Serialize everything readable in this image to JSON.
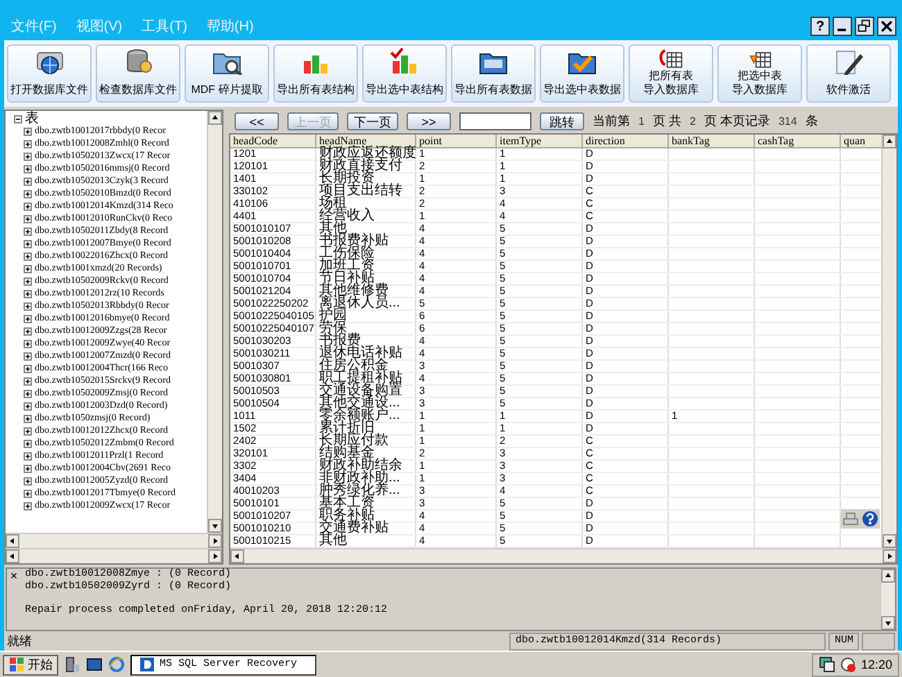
{
  "menu": [
    "文件(F)",
    "视图(V)",
    "工具(T)",
    "帮助(H)"
  ],
  "window_controls": {
    "help": "?"
  },
  "toolbar": [
    {
      "label": "打开数据库文件"
    },
    {
      "label": "检查数据库文件"
    },
    {
      "label": "MDF 碎片提取"
    },
    {
      "label": "导出所有表结构"
    },
    {
      "label": "导出选中表结构"
    },
    {
      "label": "导出所有表数据"
    },
    {
      "label": "导出选中表数据"
    },
    {
      "label": "把所有表",
      "label_2": "导入数据库"
    },
    {
      "label": "把选中表",
      "label_2": "导入数据库"
    },
    {
      "label": "软件激活"
    }
  ],
  "tree": {
    "label": "表",
    "expanded": true,
    "children": [
      {
        "label": "dbo.zwtb10012017rbbdy(0 Recor",
        "expanded": false
      },
      {
        "label": "dbo.zwtb10012008Zmhl(0 Record",
        "expanded": false
      },
      {
        "label": "dbo.zwtb10502013Zwcx(17 Recor",
        "expanded": false
      },
      {
        "label": "dbo.zwtb10502016mmsj(0 Record",
        "expanded": false
      },
      {
        "label": "dbo.zwtb10502013Czyk(3 Record",
        "expanded": false
      },
      {
        "label": "dbo.zwtb10502010Bmzd(0 Record",
        "expanded": false
      },
      {
        "label": "dbo.zwtb10012014Kmzd(314 Reco",
        "expanded": false
      },
      {
        "label": "dbo.zwtb10012010RunCkv(0 Reco",
        "expanded": false
      },
      {
        "label": "dbo.zwtb10502011Zbdy(8 Record",
        "expanded": false
      },
      {
        "label": "dbo.zwtb10012007Bmye(0 Record",
        "expanded": false
      },
      {
        "label": "dbo.zwtb10022016Zhcx(0 Record",
        "expanded": false
      },
      {
        "label": "dbo.zwtb1001xmzd(20 Records)",
        "expanded": false
      },
      {
        "label": "dbo.zwtb10502009Rckv(0 Record",
        "expanded": false
      },
      {
        "label": "dbo.zwtb10012012rz(10 Records",
        "expanded": false
      },
      {
        "label": "dbo.zwtb10502013Rbbdy(0 Recor",
        "expanded": false
      },
      {
        "label": "dbo.zwtb10012016bmye(0 Record",
        "expanded": false
      },
      {
        "label": "dbo.zwtb10012009Zzgs(28 Recor",
        "expanded": false
      },
      {
        "label": "dbo.zwtb10012009Zwye(40 Recor",
        "expanded": false
      },
      {
        "label": "dbo.zwtb10012007Zmzd(0 Record",
        "expanded": false
      },
      {
        "label": "dbo.zwtb10012004Thcr(166 Reco",
        "expanded": false
      },
      {
        "label": "dbo.zwtb10502015Srckv(9 Record",
        "expanded": false
      },
      {
        "label": "dbo.zwtb10502009Zmsj(0 Record",
        "expanded": false
      },
      {
        "label": "dbo.zwtb10012003Dzd(0 Record)",
        "expanded": false
      },
      {
        "label": "dbo.zwtb1050zmsj(0 Record)",
        "expanded": false
      },
      {
        "label": "dbo.zwtb10012012Zhcx(0 Record",
        "expanded": false
      },
      {
        "label": "dbo.zwtb10502012Zmbm(0 Record",
        "expanded": false
      },
      {
        "label": "dbo.zwtb10012011Przl(1 Record",
        "expanded": false
      },
      {
        "label": "dbo.zwtb10012004Cbv(2691 Reco",
        "expanded": false
      },
      {
        "label": "dbo.zwtb10012005Zyzd(0 Record",
        "expanded": false
      },
      {
        "label": "dbo.zwtb10012017Tbmye(0 Record",
        "expanded": false
      },
      {
        "label": "dbo.zwtb10012009Zwcx(17 Recor",
        "expanded": false
      }
    ]
  },
  "pager": {
    "first": "<<",
    "prev": {
      "label": "上一页",
      "disabled": true
    },
    "next": {
      "label": "下一页",
      "disabled": false
    },
    "last": ">>",
    "go": "跳转",
    "info": [
      {
        "text": "当前第",
        "kind": "label"
      },
      {
        "text": "1",
        "kind": "value"
      },
      {
        "text": "页 共",
        "kind": "label"
      },
      {
        "text": "2",
        "kind": "value"
      },
      {
        "text": "页 本页记录",
        "kind": "label"
      },
      {
        "text": "314",
        "kind": "value"
      },
      {
        "text": "条",
        "kind": "label"
      }
    ]
  },
  "table": {
    "columns": [
      "headCode",
      "headName",
      "point",
      "itemType",
      "direction",
      "bankTag",
      "cashTag",
      "quan"
    ],
    "rows": [
      [
        "1201",
        "财政应返还额度",
        "1",
        "1",
        "D"
      ],
      [
        "120101",
        "财政直接支付",
        "2",
        "1",
        "D"
      ],
      [
        "1401",
        "长期投资",
        "1",
        "1",
        "D"
      ],
      [
        "330102",
        "项目支出结转",
        "2",
        "3",
        "C"
      ],
      [
        "410106",
        "场租",
        "2",
        "4",
        "C"
      ],
      [
        "4401",
        "经营收入",
        "1",
        "4",
        "C"
      ],
      [
        "5001010107",
        "其他",
        "4",
        "5",
        "D"
      ],
      [
        "5001010208",
        "书报费补贴",
        "4",
        "5",
        "D"
      ],
      [
        "5001010404",
        "工伤保险",
        "4",
        "5",
        "D"
      ],
      [
        "5001010701",
        "加班工资",
        "4",
        "5",
        "D"
      ],
      [
        "5001010704",
        "节日补贴",
        "4",
        "5",
        "D"
      ],
      [
        "5001021204",
        "其他维修费",
        "4",
        "5",
        "D"
      ],
      [
        "5001022250202",
        "离退休人员...",
        "5",
        "5",
        "D"
      ],
      [
        "50010225040105",
        "护园",
        "6",
        "5",
        "D"
      ],
      [
        "50010225040107",
        "劳保",
        "6",
        "5",
        "D"
      ],
      [
        "5001030203",
        "书报费",
        "4",
        "5",
        "D"
      ],
      [
        "5001030211",
        "退休电话补贴",
        "4",
        "5",
        "D"
      ],
      [
        "50010307",
        "住房公积金",
        "3",
        "5",
        "D"
      ],
      [
        "5001030801",
        "职工提租补贴",
        "4",
        "5",
        "D"
      ],
      [
        "50010503",
        "交通设备购置",
        "3",
        "5",
        "D"
      ],
      [
        "50010504",
        "其他交通设...",
        "3",
        "5",
        "D"
      ],
      [
        "1011",
        "零余额账户...",
        "1",
        "1",
        "D",
        "1"
      ],
      [
        "1502",
        "累计折旧",
        "1",
        "1",
        "D"
      ],
      [
        "2402",
        "长期应付款",
        "1",
        "2",
        "C"
      ],
      [
        "320101",
        "结购基金",
        "2",
        "3",
        "C"
      ],
      [
        "3302",
        "财政补助结余",
        "1",
        "3",
        "C"
      ],
      [
        "3404",
        "非财政补助...",
        "1",
        "3",
        "C"
      ],
      [
        "40010203",
        "肿秀绿化养...",
        "3",
        "4",
        "C"
      ],
      [
        "50010101",
        "基本工资",
        "3",
        "5",
        "D"
      ],
      [
        "5001010207",
        "职务补贴",
        "4",
        "5",
        "D"
      ],
      [
        "5001010210",
        "交通费补贴",
        "4",
        "5",
        "D"
      ],
      [
        "5001010215",
        "其他",
        "4",
        "5",
        "D"
      ]
    ]
  },
  "log": {
    "entries": [
      "dbo.zwtb10012008Zmye : (0 Record)",
      "dbo.zwtb10502009Zyrd : (0 Record)"
    ],
    "summary": "Repair process completed onFriday, April 20, 2018 12:20:12"
  },
  "log_close": "×",
  "status_bar": {
    "message": "就绪",
    "table": "dbo.zwtb10012014Kmzd(314 Records)",
    "num": "NUM"
  },
  "taskbar": {
    "start": "开始",
    "tasks": [
      {
        "label": "MS SQL Server Recovery",
        "selected": true
      }
    ],
    "clock": "12:20"
  }
}
